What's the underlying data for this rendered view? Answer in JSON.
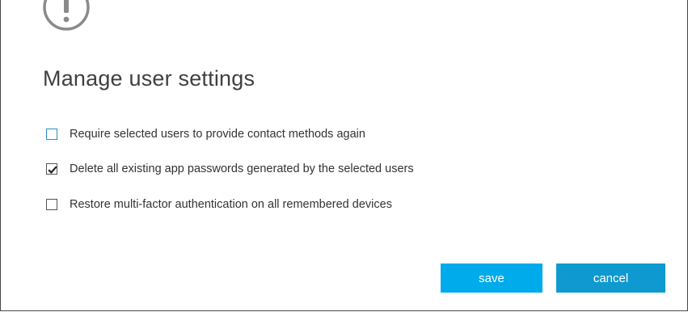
{
  "dialog": {
    "icon": "exclamation-circle-icon",
    "title": "Manage user settings",
    "options": [
      {
        "label": "Require selected users to provide contact methods again",
        "checked": false
      },
      {
        "label": "Delete all existing app passwords generated by the selected users",
        "checked": true
      },
      {
        "label": "Restore multi-factor authentication on all remembered devices",
        "checked": false
      }
    ],
    "buttons": {
      "save_label": "save",
      "cancel_label": "cancel"
    },
    "colors": {
      "save": "#00abec",
      "cancel": "#0e9ad0",
      "focus": "#2a8dc8"
    }
  }
}
